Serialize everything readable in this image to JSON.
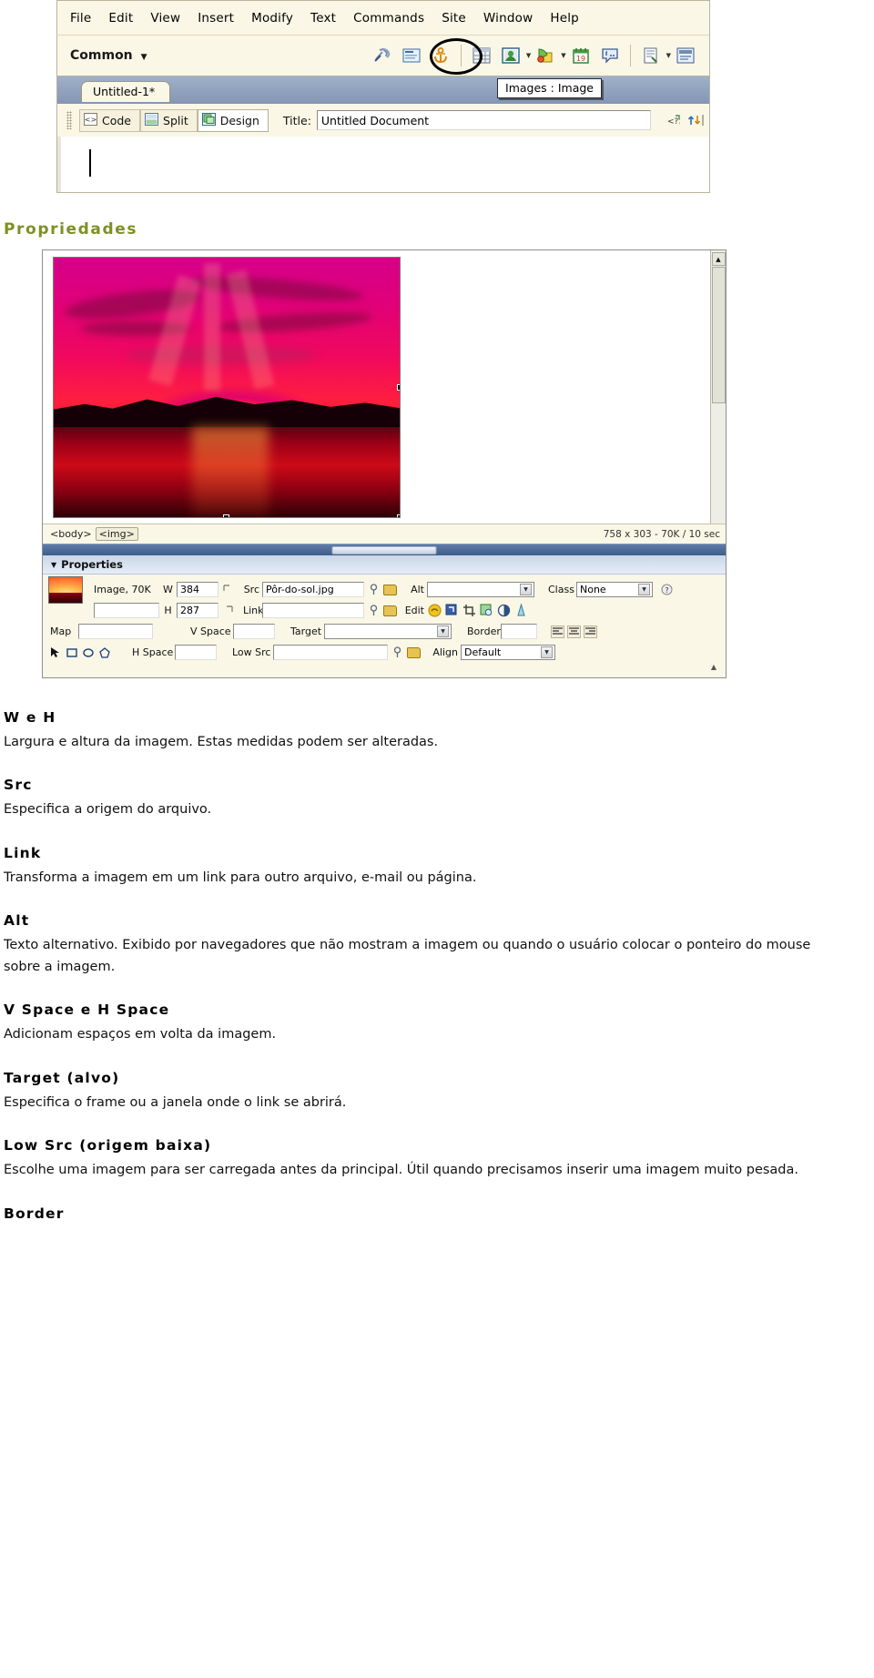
{
  "dreamweaver": {
    "menubar": [
      "File",
      "Edit",
      "View",
      "Insert",
      "Modify",
      "Text",
      "Commands",
      "Site",
      "Window",
      "Help"
    ],
    "toolbar": {
      "category_label": "Common",
      "category_caret": "▼",
      "icons": [
        "hyperlink-icon",
        "email-link-icon",
        "named-anchor-icon",
        "table-icon",
        "image-icon",
        "media-icon",
        "date-icon",
        "comment-icon",
        "template-icon",
        "tag-chooser-icon"
      ],
      "highlighted_icon": "image-icon"
    },
    "document": {
      "tab_label": "Untitled-1*",
      "tooltip": "Images : Image",
      "view_buttons": [
        {
          "label": "Code",
          "icon": "code-view-icon",
          "active": false
        },
        {
          "label": "Split",
          "icon": "split-view-icon",
          "active": false
        },
        {
          "label": "Design",
          "icon": "design-view-icon",
          "active": true
        }
      ],
      "title_label": "Title:",
      "title_value": "Untitled Document",
      "title_placeholder": "Untitled Document",
      "right_icons": [
        "code-navigation-icon",
        "file-management-icon"
      ]
    }
  },
  "section": {
    "heading": "Propriedades",
    "heading_color": "#7d9023"
  },
  "properties_window": {
    "image_alt": "Pôr-do-sol",
    "statusbar": {
      "tags": [
        "<body>",
        "<img>"
      ],
      "selected_tag": "<img>",
      "info": "758 x 303 - 70K / 10 sec"
    },
    "panel_title": "Properties",
    "panel_triangle": "▼",
    "fields": {
      "type_label": "Image, 70K",
      "name_value": "",
      "name_placeholder": "",
      "w_label": "W",
      "w_value": "384",
      "h_label": "H",
      "h_value": "287",
      "src_label": "Src",
      "src_value": "Pôr-do-sol.jpg",
      "link_label": "Link",
      "link_value": "",
      "alt_label": "Alt",
      "alt_value": "",
      "edit_label": "Edit",
      "edit_icons": [
        "edit-fireworks-icon",
        "optimize-icon",
        "crop-icon",
        "resample-icon",
        "brightness-contrast-icon",
        "sharpen-icon"
      ],
      "class_label": "Class",
      "class_value": "None",
      "map_label": "Map",
      "map_value": "",
      "hotspot_icons": [
        "pointer-hotspot-icon",
        "rectangle-hotspot-icon",
        "oval-hotspot-icon",
        "polygon-hotspot-icon"
      ],
      "vspace_label": "V Space",
      "vspace_value": "",
      "hspace_label": "H Space",
      "hspace_value": "",
      "target_label": "Target",
      "target_value": "",
      "lowsrc_label": "Low Src",
      "lowsrc_value": "",
      "border_label": "Border",
      "border_value": "",
      "align_label": "Align",
      "align_value": "Default",
      "align_buttons": [
        "align-left-icon",
        "align-center-icon",
        "align-right-icon"
      ]
    }
  },
  "content": [
    {
      "term": "W e H",
      "desc": "Largura e altura da imagem. Estas medidas podem ser alteradas."
    },
    {
      "term": "Src",
      "desc": "Especifica a origem do arquivo."
    },
    {
      "term": "Link",
      "desc": "Transforma a imagem em um link para outro arquivo, e-mail ou página."
    },
    {
      "term": "Alt",
      "desc": "Texto alternativo. Exibido por navegadores que não mostram a imagem ou quando o usuário colocar o ponteiro do mouse sobre a imagem."
    },
    {
      "term": "V Space e H Space",
      "desc": "Adicionam espaços em volta da imagem."
    },
    {
      "term": "Target (alvo)",
      "desc": "Especifica o frame ou a janela onde o link se abrirá."
    },
    {
      "term": "Low Src (origem baixa)",
      "desc": "Escolhe uma imagem para ser carregada antes da principal. Útil quando precisamos inserir uma imagem muito pesada."
    },
    {
      "term": "Border",
      "desc": ""
    }
  ]
}
